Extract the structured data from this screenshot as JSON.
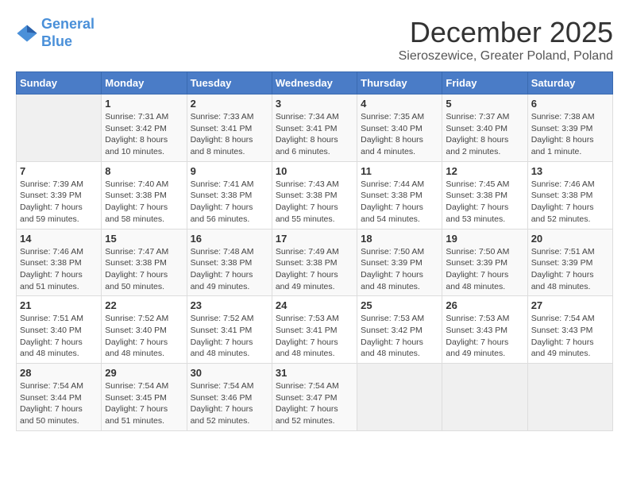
{
  "logo": {
    "line1": "General",
    "line2": "Blue"
  },
  "title": "December 2025",
  "subtitle": "Sieroszewice, Greater Poland, Poland",
  "days_of_week": [
    "Sunday",
    "Monday",
    "Tuesday",
    "Wednesday",
    "Thursday",
    "Friday",
    "Saturday"
  ],
  "weeks": [
    [
      {
        "day": "",
        "info": ""
      },
      {
        "day": "1",
        "info": "Sunrise: 7:31 AM\nSunset: 3:42 PM\nDaylight: 8 hours\nand 10 minutes."
      },
      {
        "day": "2",
        "info": "Sunrise: 7:33 AM\nSunset: 3:41 PM\nDaylight: 8 hours\nand 8 minutes."
      },
      {
        "day": "3",
        "info": "Sunrise: 7:34 AM\nSunset: 3:41 PM\nDaylight: 8 hours\nand 6 minutes."
      },
      {
        "day": "4",
        "info": "Sunrise: 7:35 AM\nSunset: 3:40 PM\nDaylight: 8 hours\nand 4 minutes."
      },
      {
        "day": "5",
        "info": "Sunrise: 7:37 AM\nSunset: 3:40 PM\nDaylight: 8 hours\nand 2 minutes."
      },
      {
        "day": "6",
        "info": "Sunrise: 7:38 AM\nSunset: 3:39 PM\nDaylight: 8 hours\nand 1 minute."
      }
    ],
    [
      {
        "day": "7",
        "info": "Sunrise: 7:39 AM\nSunset: 3:39 PM\nDaylight: 7 hours\nand 59 minutes."
      },
      {
        "day": "8",
        "info": "Sunrise: 7:40 AM\nSunset: 3:38 PM\nDaylight: 7 hours\nand 58 minutes."
      },
      {
        "day": "9",
        "info": "Sunrise: 7:41 AM\nSunset: 3:38 PM\nDaylight: 7 hours\nand 56 minutes."
      },
      {
        "day": "10",
        "info": "Sunrise: 7:43 AM\nSunset: 3:38 PM\nDaylight: 7 hours\nand 55 minutes."
      },
      {
        "day": "11",
        "info": "Sunrise: 7:44 AM\nSunset: 3:38 PM\nDaylight: 7 hours\nand 54 minutes."
      },
      {
        "day": "12",
        "info": "Sunrise: 7:45 AM\nSunset: 3:38 PM\nDaylight: 7 hours\nand 53 minutes."
      },
      {
        "day": "13",
        "info": "Sunrise: 7:46 AM\nSunset: 3:38 PM\nDaylight: 7 hours\nand 52 minutes."
      }
    ],
    [
      {
        "day": "14",
        "info": "Sunrise: 7:46 AM\nSunset: 3:38 PM\nDaylight: 7 hours\nand 51 minutes."
      },
      {
        "day": "15",
        "info": "Sunrise: 7:47 AM\nSunset: 3:38 PM\nDaylight: 7 hours\nand 50 minutes."
      },
      {
        "day": "16",
        "info": "Sunrise: 7:48 AM\nSunset: 3:38 PM\nDaylight: 7 hours\nand 49 minutes."
      },
      {
        "day": "17",
        "info": "Sunrise: 7:49 AM\nSunset: 3:38 PM\nDaylight: 7 hours\nand 49 minutes."
      },
      {
        "day": "18",
        "info": "Sunrise: 7:50 AM\nSunset: 3:39 PM\nDaylight: 7 hours\nand 48 minutes."
      },
      {
        "day": "19",
        "info": "Sunrise: 7:50 AM\nSunset: 3:39 PM\nDaylight: 7 hours\nand 48 minutes."
      },
      {
        "day": "20",
        "info": "Sunrise: 7:51 AM\nSunset: 3:39 PM\nDaylight: 7 hours\nand 48 minutes."
      }
    ],
    [
      {
        "day": "21",
        "info": "Sunrise: 7:51 AM\nSunset: 3:40 PM\nDaylight: 7 hours\nand 48 minutes."
      },
      {
        "day": "22",
        "info": "Sunrise: 7:52 AM\nSunset: 3:40 PM\nDaylight: 7 hours\nand 48 minutes."
      },
      {
        "day": "23",
        "info": "Sunrise: 7:52 AM\nSunset: 3:41 PM\nDaylight: 7 hours\nand 48 minutes."
      },
      {
        "day": "24",
        "info": "Sunrise: 7:53 AM\nSunset: 3:41 PM\nDaylight: 7 hours\nand 48 minutes."
      },
      {
        "day": "25",
        "info": "Sunrise: 7:53 AM\nSunset: 3:42 PM\nDaylight: 7 hours\nand 48 minutes."
      },
      {
        "day": "26",
        "info": "Sunrise: 7:53 AM\nSunset: 3:43 PM\nDaylight: 7 hours\nand 49 minutes."
      },
      {
        "day": "27",
        "info": "Sunrise: 7:54 AM\nSunset: 3:43 PM\nDaylight: 7 hours\nand 49 minutes."
      }
    ],
    [
      {
        "day": "28",
        "info": "Sunrise: 7:54 AM\nSunset: 3:44 PM\nDaylight: 7 hours\nand 50 minutes."
      },
      {
        "day": "29",
        "info": "Sunrise: 7:54 AM\nSunset: 3:45 PM\nDaylight: 7 hours\nand 51 minutes."
      },
      {
        "day": "30",
        "info": "Sunrise: 7:54 AM\nSunset: 3:46 PM\nDaylight: 7 hours\nand 52 minutes."
      },
      {
        "day": "31",
        "info": "Sunrise: 7:54 AM\nSunset: 3:47 PM\nDaylight: 7 hours\nand 52 minutes."
      },
      {
        "day": "",
        "info": ""
      },
      {
        "day": "",
        "info": ""
      },
      {
        "day": "",
        "info": ""
      }
    ]
  ]
}
